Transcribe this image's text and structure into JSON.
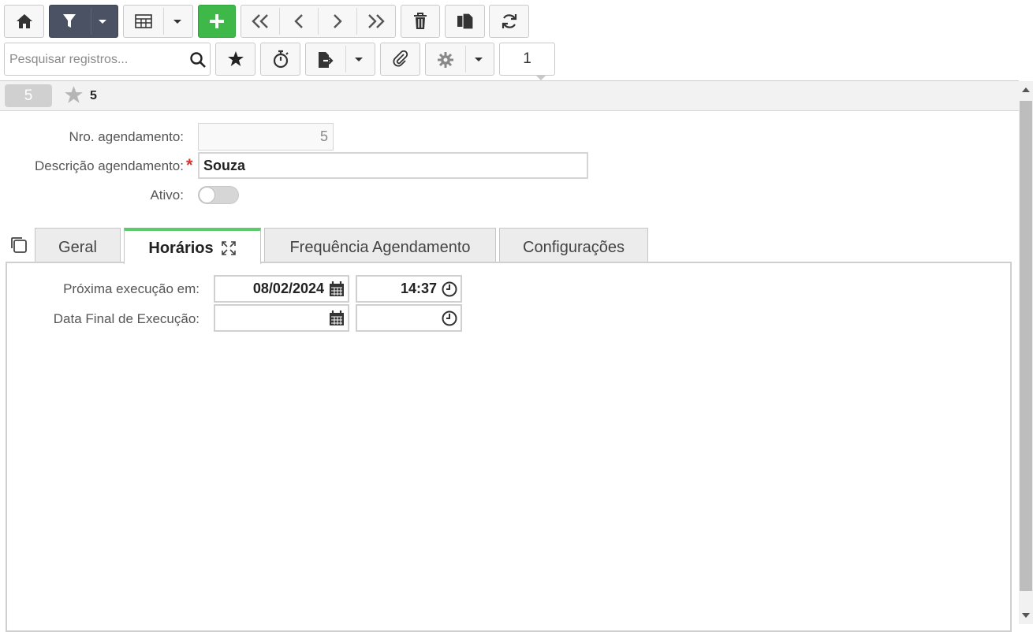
{
  "toolbar": {
    "row1": [
      {
        "name": "home-button",
        "icon": "home-icon"
      },
      {
        "name": "filter-button",
        "icon": "filter-icon"
      },
      {
        "name": "grid-view-button",
        "icon": "table-icon"
      },
      {
        "name": "add-record-button",
        "icon": "plus-icon"
      },
      {
        "name": "first-record-button",
        "icon": "double-chevron-left-icon"
      },
      {
        "name": "previous-record-button",
        "icon": "chevron-left-icon"
      },
      {
        "name": "next-record-button",
        "icon": "chevron-right-icon"
      },
      {
        "name": "last-record-button",
        "icon": "double-chevron-right-icon"
      },
      {
        "name": "delete-button",
        "icon": "trash-icon"
      },
      {
        "name": "duplicate-button",
        "icon": "copy-icon"
      },
      {
        "name": "refresh-button",
        "icon": "refresh-icon"
      }
    ],
    "row2": [
      {
        "name": "favorite-button",
        "icon": "star-icon"
      },
      {
        "name": "timer-button",
        "icon": "stopwatch-icon"
      },
      {
        "name": "export-button",
        "icon": "export-icon"
      },
      {
        "name": "attachment-button",
        "icon": "paperclip-icon"
      },
      {
        "name": "settings-button",
        "icon": "gear-icon"
      }
    ]
  },
  "search": {
    "placeholder": "Pesquisar registros..."
  },
  "pager": {
    "current": "1"
  },
  "record": {
    "id_badge": "5",
    "title": "5"
  },
  "form": {
    "nro_label": "Nro. agendamento:",
    "nro_value": "5",
    "desc_label": "Descrição agendamento:",
    "desc_required": "*",
    "desc_value": "Souza",
    "ativo_label": "Ativo:",
    "ativo_value": false
  },
  "tabs": [
    {
      "label": "Geral",
      "active": false
    },
    {
      "label": "Horários",
      "active": true
    },
    {
      "label": "Frequência Agendamento",
      "active": false
    },
    {
      "label": "Configurações",
      "active": false
    }
  ],
  "schedule": {
    "next_label": "Próxima execução em:",
    "next_date": "08/02/2024",
    "next_time": "14:37",
    "end_label": "Data Final de Execução:",
    "end_date": "",
    "end_time": ""
  },
  "colors": {
    "accent_green": "#3fb84a",
    "tab_active_border": "#5cc96a",
    "dark_button": "#4a5263",
    "required": "#d9342b"
  }
}
